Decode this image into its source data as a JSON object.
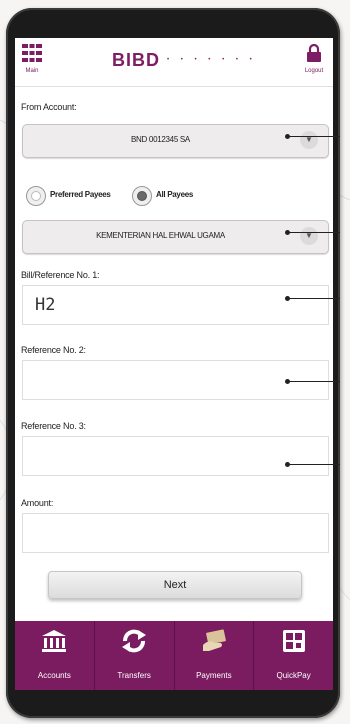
{
  "header": {
    "menu_caption": "Main",
    "brand": "BIBD",
    "dots": "• • • • • • •",
    "logout_caption": "Logout"
  },
  "form": {
    "from_account_label": "From Account:",
    "from_account_value": "BND 0012345 SA",
    "payee_options": [
      "Preferred Payees",
      "All Payees"
    ],
    "selected_payee_option": "All Payees",
    "payee_value": "KEMENTERIAN HAL EHWAL UGAMA",
    "bill_ref_label": "Bill/Reference No. 1:",
    "bill_ref_value": "H2",
    "ref2_label": "Reference No. 2:",
    "ref2_value": "",
    "ref3_label": "Reference No. 3:",
    "ref3_value": "",
    "amount_label": "Amount:",
    "amount_value": ""
  },
  "next_label": "Next",
  "tabs": [
    {
      "label": "Accounts",
      "icon": "bank-icon"
    },
    {
      "label": "Transfers",
      "icon": "transfer-icon"
    },
    {
      "label": "Payments",
      "icon": "payments-icon"
    },
    {
      "label": "QuickPay",
      "icon": "quickpay-icon"
    }
  ],
  "colors": {
    "brand": "#7d1d63",
    "tabbar": "#7a1c5f"
  }
}
